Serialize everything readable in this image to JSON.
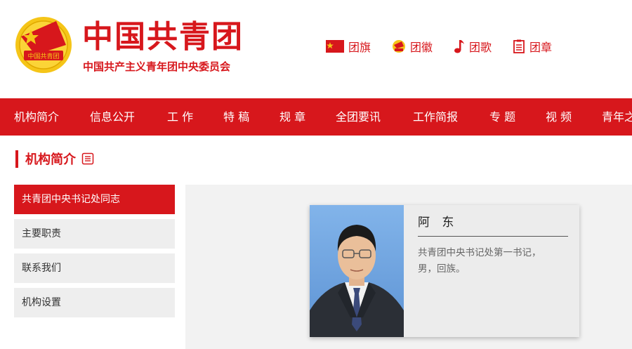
{
  "header": {
    "title": "中国共青团",
    "subtitle": "中国共产主义青年团中央委员会",
    "emblem_text": "中国共青团",
    "quick_links": [
      {
        "label": "团旗",
        "icon": "flag-icon"
      },
      {
        "label": "团徽",
        "icon": "emblem-icon"
      },
      {
        "label": "团歌",
        "icon": "music-note-icon"
      },
      {
        "label": "团章",
        "icon": "document-icon"
      }
    ]
  },
  "nav": {
    "items": [
      "机构简介",
      "信息公开",
      "工 作",
      "特 稿",
      "规 章",
      "全团要讯",
      "工作简报",
      "专 题",
      "视 频",
      "青年之"
    ]
  },
  "section": {
    "title": "机构简介"
  },
  "sidebar": {
    "items": [
      {
        "label": "共青团中央书记处同志",
        "active": true
      },
      {
        "label": "主要职责",
        "active": false
      },
      {
        "label": "联系我们",
        "active": false
      },
      {
        "label": "机构设置",
        "active": false
      }
    ]
  },
  "profile": {
    "name": "阿 东",
    "description": "共青团中央书记处第一书记，男，回族。"
  },
  "colors": {
    "brand_red": "#d7171c",
    "photo_background": "#74a9e0"
  }
}
